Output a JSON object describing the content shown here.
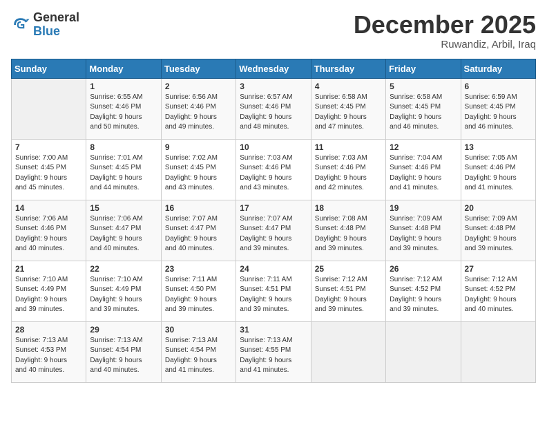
{
  "header": {
    "logo_general": "General",
    "logo_blue": "Blue",
    "month_title": "December 2025",
    "location": "Ruwandiz, Arbil, Iraq"
  },
  "days_of_week": [
    "Sunday",
    "Monday",
    "Tuesday",
    "Wednesday",
    "Thursday",
    "Friday",
    "Saturday"
  ],
  "weeks": [
    [
      {
        "day": "",
        "info": ""
      },
      {
        "day": "1",
        "info": "Sunrise: 6:55 AM\nSunset: 4:46 PM\nDaylight: 9 hours\nand 50 minutes."
      },
      {
        "day": "2",
        "info": "Sunrise: 6:56 AM\nSunset: 4:46 PM\nDaylight: 9 hours\nand 49 minutes."
      },
      {
        "day": "3",
        "info": "Sunrise: 6:57 AM\nSunset: 4:46 PM\nDaylight: 9 hours\nand 48 minutes."
      },
      {
        "day": "4",
        "info": "Sunrise: 6:58 AM\nSunset: 4:45 PM\nDaylight: 9 hours\nand 47 minutes."
      },
      {
        "day": "5",
        "info": "Sunrise: 6:58 AM\nSunset: 4:45 PM\nDaylight: 9 hours\nand 46 minutes."
      },
      {
        "day": "6",
        "info": "Sunrise: 6:59 AM\nSunset: 4:45 PM\nDaylight: 9 hours\nand 46 minutes."
      }
    ],
    [
      {
        "day": "7",
        "info": "Sunrise: 7:00 AM\nSunset: 4:45 PM\nDaylight: 9 hours\nand 45 minutes."
      },
      {
        "day": "8",
        "info": "Sunrise: 7:01 AM\nSunset: 4:45 PM\nDaylight: 9 hours\nand 44 minutes."
      },
      {
        "day": "9",
        "info": "Sunrise: 7:02 AM\nSunset: 4:45 PM\nDaylight: 9 hours\nand 43 minutes."
      },
      {
        "day": "10",
        "info": "Sunrise: 7:03 AM\nSunset: 4:46 PM\nDaylight: 9 hours\nand 43 minutes."
      },
      {
        "day": "11",
        "info": "Sunrise: 7:03 AM\nSunset: 4:46 PM\nDaylight: 9 hours\nand 42 minutes."
      },
      {
        "day": "12",
        "info": "Sunrise: 7:04 AM\nSunset: 4:46 PM\nDaylight: 9 hours\nand 41 minutes."
      },
      {
        "day": "13",
        "info": "Sunrise: 7:05 AM\nSunset: 4:46 PM\nDaylight: 9 hours\nand 41 minutes."
      }
    ],
    [
      {
        "day": "14",
        "info": "Sunrise: 7:06 AM\nSunset: 4:46 PM\nDaylight: 9 hours\nand 40 minutes."
      },
      {
        "day": "15",
        "info": "Sunrise: 7:06 AM\nSunset: 4:47 PM\nDaylight: 9 hours\nand 40 minutes."
      },
      {
        "day": "16",
        "info": "Sunrise: 7:07 AM\nSunset: 4:47 PM\nDaylight: 9 hours\nand 40 minutes."
      },
      {
        "day": "17",
        "info": "Sunrise: 7:07 AM\nSunset: 4:47 PM\nDaylight: 9 hours\nand 39 minutes."
      },
      {
        "day": "18",
        "info": "Sunrise: 7:08 AM\nSunset: 4:48 PM\nDaylight: 9 hours\nand 39 minutes."
      },
      {
        "day": "19",
        "info": "Sunrise: 7:09 AM\nSunset: 4:48 PM\nDaylight: 9 hours\nand 39 minutes."
      },
      {
        "day": "20",
        "info": "Sunrise: 7:09 AM\nSunset: 4:48 PM\nDaylight: 9 hours\nand 39 minutes."
      }
    ],
    [
      {
        "day": "21",
        "info": "Sunrise: 7:10 AM\nSunset: 4:49 PM\nDaylight: 9 hours\nand 39 minutes."
      },
      {
        "day": "22",
        "info": "Sunrise: 7:10 AM\nSunset: 4:49 PM\nDaylight: 9 hours\nand 39 minutes."
      },
      {
        "day": "23",
        "info": "Sunrise: 7:11 AM\nSunset: 4:50 PM\nDaylight: 9 hours\nand 39 minutes."
      },
      {
        "day": "24",
        "info": "Sunrise: 7:11 AM\nSunset: 4:51 PM\nDaylight: 9 hours\nand 39 minutes."
      },
      {
        "day": "25",
        "info": "Sunrise: 7:12 AM\nSunset: 4:51 PM\nDaylight: 9 hours\nand 39 minutes."
      },
      {
        "day": "26",
        "info": "Sunrise: 7:12 AM\nSunset: 4:52 PM\nDaylight: 9 hours\nand 39 minutes."
      },
      {
        "day": "27",
        "info": "Sunrise: 7:12 AM\nSunset: 4:52 PM\nDaylight: 9 hours\nand 40 minutes."
      }
    ],
    [
      {
        "day": "28",
        "info": "Sunrise: 7:13 AM\nSunset: 4:53 PM\nDaylight: 9 hours\nand 40 minutes."
      },
      {
        "day": "29",
        "info": "Sunrise: 7:13 AM\nSunset: 4:54 PM\nDaylight: 9 hours\nand 40 minutes."
      },
      {
        "day": "30",
        "info": "Sunrise: 7:13 AM\nSunset: 4:54 PM\nDaylight: 9 hours\nand 41 minutes."
      },
      {
        "day": "31",
        "info": "Sunrise: 7:13 AM\nSunset: 4:55 PM\nDaylight: 9 hours\nand 41 minutes."
      },
      {
        "day": "",
        "info": ""
      },
      {
        "day": "",
        "info": ""
      },
      {
        "day": "",
        "info": ""
      }
    ]
  ]
}
